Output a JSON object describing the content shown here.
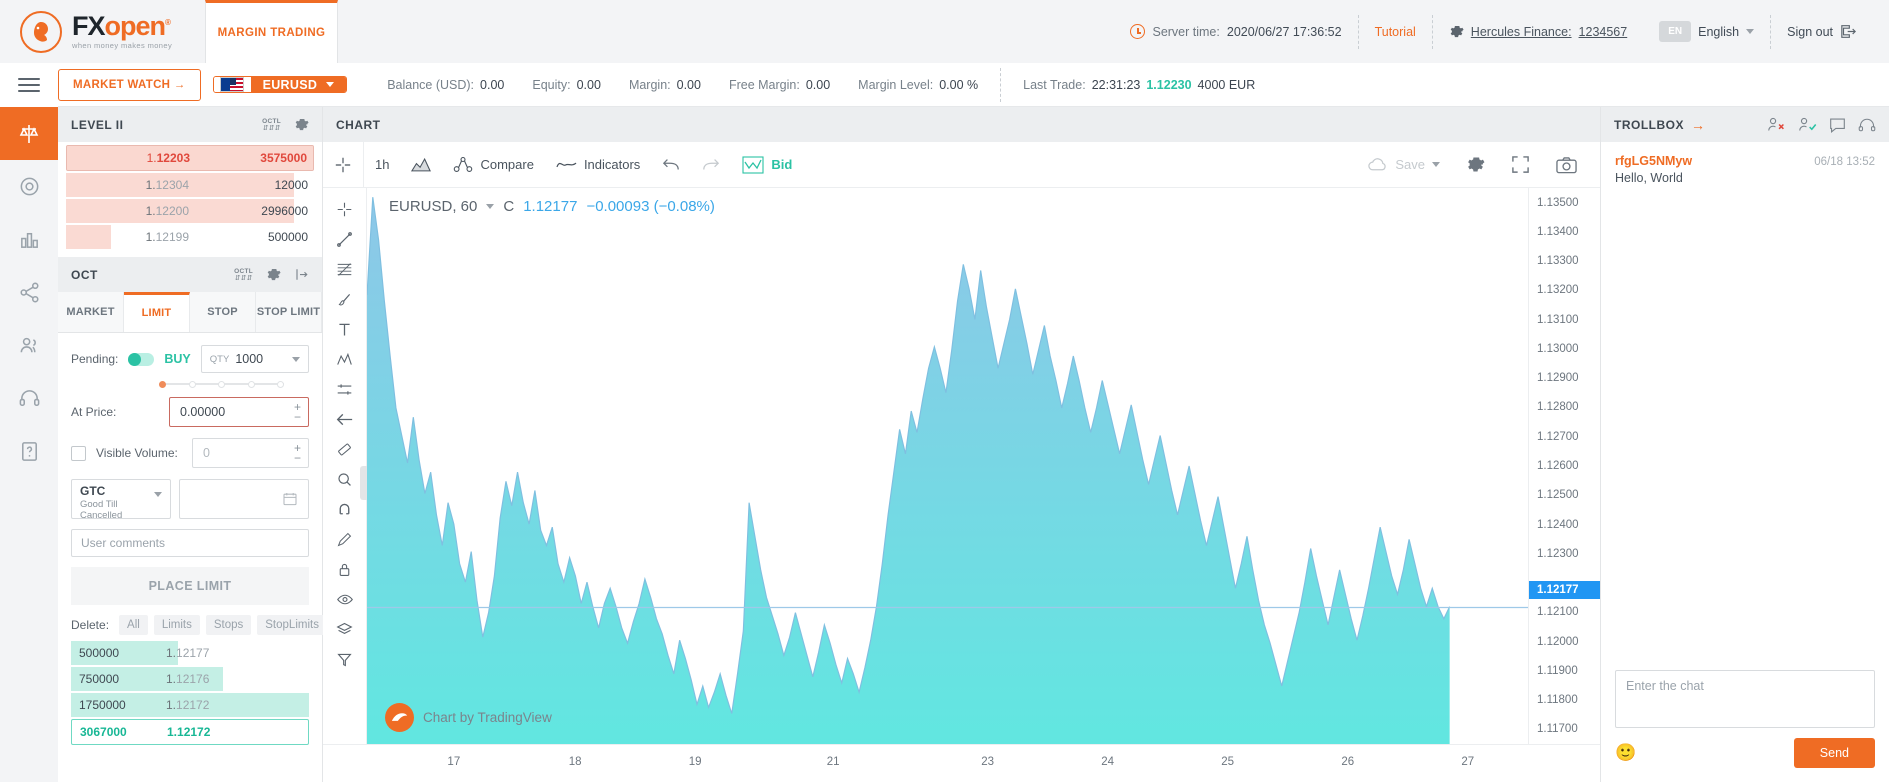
{
  "brand": {
    "name_fx": "FX",
    "name_open": "open",
    "reg": "®",
    "tagline": "when money makes money",
    "tab": "MARGIN TRADING"
  },
  "header": {
    "server_time_label": "Server time:",
    "server_time_value": "2020/06/27 17:36:52",
    "tutorial": "Tutorial",
    "account_label": "Hercules Finance:",
    "account_number": "1234567",
    "lang_code": "EN",
    "lang_name": "English",
    "sign_out": "Sign out"
  },
  "accountbar": {
    "market_watch": "MARKET WATCH →",
    "symbol": "EURUSD",
    "stats": [
      {
        "label": "Balance (USD):",
        "value": "0.00"
      },
      {
        "label": "Equity:",
        "value": "0.00"
      },
      {
        "label": "Margin:",
        "value": "0.00"
      },
      {
        "label": "Free Margin:",
        "value": "0.00"
      },
      {
        "label": "Margin Level:",
        "value": "0.00 %"
      }
    ],
    "last_trade_label": "Last Trade:",
    "last_trade_time": "22:31:23",
    "last_trade_price": "1.12230",
    "last_trade_size": "4000 EUR"
  },
  "level2": {
    "title": "LEVEL II",
    "rows": [
      {
        "price_pre": "1.",
        "price_post": "12203",
        "qty": "3575000",
        "fill": 100,
        "top": true
      },
      {
        "price_pre": "1.",
        "price_post": "12304",
        "qty": "12000",
        "fill": 92,
        "top": false
      },
      {
        "price_pre": "1.",
        "price_post": "12200",
        "qty": "2996000",
        "fill": 92,
        "top": false
      },
      {
        "price_pre": "1.",
        "price_post": "12199",
        "qty": "500000",
        "fill": 18,
        "top": false
      }
    ]
  },
  "oct": {
    "title": "OCT",
    "tabs": [
      {
        "label": "MARKET",
        "active": false
      },
      {
        "label": "LIMIT",
        "active": true
      },
      {
        "label": "STOP",
        "active": false
      },
      {
        "label": "STOP LIMIT",
        "active": false
      }
    ],
    "pending_label": "Pending:",
    "side": "BUY",
    "qty_tag": "QTY",
    "qty_value": "1000",
    "at_price_label": "At Price:",
    "at_price_value": "0.00000",
    "visible_volume_label": "Visible Volume:",
    "visible_volume_value": "0",
    "gtc_code": "GTC",
    "gtc_name": "Good Till Cancelled",
    "comments_placeholder": "User comments",
    "place_button": "PLACE LIMIT",
    "delete_label": "Delete:",
    "delete_chips": [
      "All",
      "Limits",
      "Stops",
      "StopLimits"
    ],
    "orders": [
      {
        "qty": "500000",
        "price_pre": "1.",
        "price_post": "12177",
        "fill": 45,
        "selected": false
      },
      {
        "qty": "750000",
        "price_pre": "1.",
        "price_post": "12176",
        "fill": 64,
        "selected": false
      },
      {
        "qty": "1750000",
        "price_pre": "1.",
        "price_post": "12172",
        "fill": 100,
        "selected": false
      },
      {
        "qty": "3067000",
        "price_pre": "1.",
        "price_post": "12172",
        "fill": 0,
        "selected": true
      }
    ]
  },
  "chart": {
    "panel_title": "CHART",
    "interval": "1h",
    "compare": "Compare",
    "indicators": "Indicators",
    "bid": "Bid",
    "save": "Save",
    "symbol_line": "EURUSD, 60",
    "close_label": "C",
    "close_value": "1.12177",
    "change": "−0.00093 (−0.08%)",
    "watermark": "Chart by TradingView",
    "current_price_label": "1.12177"
  },
  "chart_data": {
    "type": "area",
    "title": "EURUSD, 60",
    "xlabel": "",
    "ylabel": "",
    "ylim": [
      1.1165,
      1.1355
    ],
    "grid": false,
    "legend": "none",
    "y_ticks": [
      "1.13500",
      "1.13400",
      "1.13300",
      "1.13200",
      "1.13100",
      "1.13000",
      "1.12900",
      "1.12800",
      "1.12700",
      "1.12600",
      "1.12500",
      "1.12400",
      "1.12300",
      "1.12100",
      "1.12000",
      "1.11900",
      "1.11800",
      "1.11700"
    ],
    "y_tick_values": [
      1.135,
      1.134,
      1.133,
      1.132,
      1.131,
      1.13,
      1.129,
      1.128,
      1.127,
      1.126,
      1.125,
      1.124,
      1.123,
      1.121,
      1.12,
      1.119,
      1.118,
      1.117
    ],
    "x_ticks": [
      "17",
      "18",
      "19",
      "21",
      "23",
      "24",
      "25",
      "26",
      "27"
    ],
    "x_tick_positions": [
      0.068,
      0.163,
      0.257,
      0.365,
      0.486,
      0.58,
      0.674,
      0.768,
      0.862
    ],
    "current_price": 1.12177,
    "series": [
      {
        "name": "EURUSD close",
        "values": [
          1.132,
          1.1352,
          1.1338,
          1.1318,
          1.13,
          1.1283,
          1.1274,
          1.1265,
          1.128,
          1.1266,
          1.1255,
          1.1262,
          1.1248,
          1.1238,
          1.1252,
          1.1245,
          1.1232,
          1.1226,
          1.1236,
          1.122,
          1.1208,
          1.1216,
          1.1228,
          1.1247,
          1.1259,
          1.1251,
          1.1262,
          1.1252,
          1.1245,
          1.1256,
          1.1243,
          1.1238,
          1.1244,
          1.1232,
          1.1226,
          1.1234,
          1.1228,
          1.1219,
          1.1226,
          1.1218,
          1.1211,
          1.1219,
          1.1224,
          1.1218,
          1.1211,
          1.1206,
          1.1213,
          1.1219,
          1.1227,
          1.1221,
          1.1214,
          1.1209,
          1.1202,
          1.1196,
          1.1207,
          1.1201,
          1.1194,
          1.1186,
          1.1192,
          1.1185,
          1.119,
          1.1196,
          1.1189,
          1.1183,
          1.1196,
          1.121,
          1.1252,
          1.1241,
          1.123,
          1.1221,
          1.1215,
          1.1209,
          1.1202,
          1.1208,
          1.1216,
          1.1209,
          1.1202,
          1.1195,
          1.1203,
          1.1212,
          1.1206,
          1.1199,
          1.1193,
          1.1201,
          1.1196,
          1.119,
          1.1198,
          1.1207,
          1.1218,
          1.1232,
          1.1248,
          1.1262,
          1.1276,
          1.1268,
          1.1282,
          1.1275,
          1.1286,
          1.1296,
          1.1303,
          1.1296,
          1.1288,
          1.1302,
          1.1318,
          1.133,
          1.1322,
          1.1312,
          1.1328,
          1.1316,
          1.1306,
          1.1296,
          1.1304,
          1.1312,
          1.1322,
          1.1313,
          1.1304,
          1.1294,
          1.1302,
          1.131,
          1.13,
          1.1292,
          1.1283,
          1.1291,
          1.13,
          1.1292,
          1.1283,
          1.1275,
          1.1283,
          1.1292,
          1.1284,
          1.1276,
          1.1268,
          1.1276,
          1.1284,
          1.1275,
          1.1266,
          1.1258,
          1.1266,
          1.1274,
          1.1265,
          1.1256,
          1.1248,
          1.1256,
          1.1264,
          1.1255,
          1.1246,
          1.1238,
          1.1246,
          1.1254,
          1.1244,
          1.1234,
          1.1224,
          1.1232,
          1.1241,
          1.123,
          1.122,
          1.1212,
          1.1206,
          1.1199,
          1.1192,
          1.12,
          1.1208,
          1.1216,
          1.1226,
          1.1237,
          1.1228,
          1.122,
          1.1212,
          1.1221,
          1.123,
          1.1222,
          1.1214,
          1.1207,
          1.1215,
          1.1224,
          1.1234,
          1.1244,
          1.1236,
          1.1228,
          1.1222,
          1.123,
          1.124,
          1.1232,
          1.1224,
          1.1218,
          1.1224,
          1.1218,
          1.1214,
          1.1218
        ]
      }
    ],
    "colors": {
      "area_top": "#8ec7e8",
      "area_bottom": "#5fe8e0",
      "line": "#7fbfe0"
    }
  },
  "trollbox": {
    "title": "TROLLBOX",
    "messages": [
      {
        "user": "rfgLG5NMyw",
        "time": "06/18 13:52",
        "text": "Hello, World"
      }
    ],
    "chat_placeholder": "Enter the chat",
    "send": "Send",
    "emoji": "🙂"
  }
}
